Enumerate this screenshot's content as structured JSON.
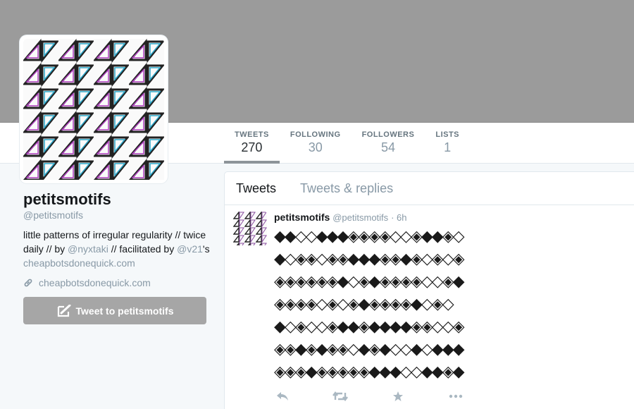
{
  "profile": {
    "name": "petitsmotifs",
    "handle": "@petitsmotifs",
    "bio_part1": "little patterns of irregular regularity // twice daily // by ",
    "bio_link1": "@nyxtaki",
    "bio_part2": " // facilitated by ",
    "bio_link2": "@v21",
    "bio_part3": "'s ",
    "bio_link3": "cheapbotsdonequick.com",
    "url": "cheapbotsdonequick.com",
    "tweet_button": "Tweet to petitsmotifs"
  },
  "stats": [
    {
      "label": "TWEETS",
      "value": "270"
    },
    {
      "label": "FOLLOWING",
      "value": "30"
    },
    {
      "label": "FOLLOWERS",
      "value": "54"
    },
    {
      "label": "LISTS",
      "value": "1"
    }
  ],
  "timeline": {
    "tabs": [
      "Tweets",
      "Tweets & replies"
    ]
  },
  "tweet": {
    "name": "petitsmotifs",
    "screen_name": "@petitsmotifs",
    "time": "· 6h",
    "lines": [
      "◆◆◇◇◆◆◆◈◈◈◈◇◇◈◆◆◈◇",
      "◆◇◈◈◇◈◈◆◆◆◈◈◆◈◇◈◇◈",
      "◈◈◈◈◈◈◆◇◈◆◈◈◈◈◇◇◈◆",
      "◈◈◈◈◇◈◇◈◆◈◈◈◈◆◇◈◇",
      "◆◇◈◇◇◈◆◆◈◆◆◆◆◈◈◇◇◈",
      "◈◈◆◈◆◈◈◇◆◈◆◇◇◆◇◆◆◆",
      "◈◈◈◆◈◈◈◈◈◆◆◆◇◇◆◆◈◆"
    ]
  }
}
